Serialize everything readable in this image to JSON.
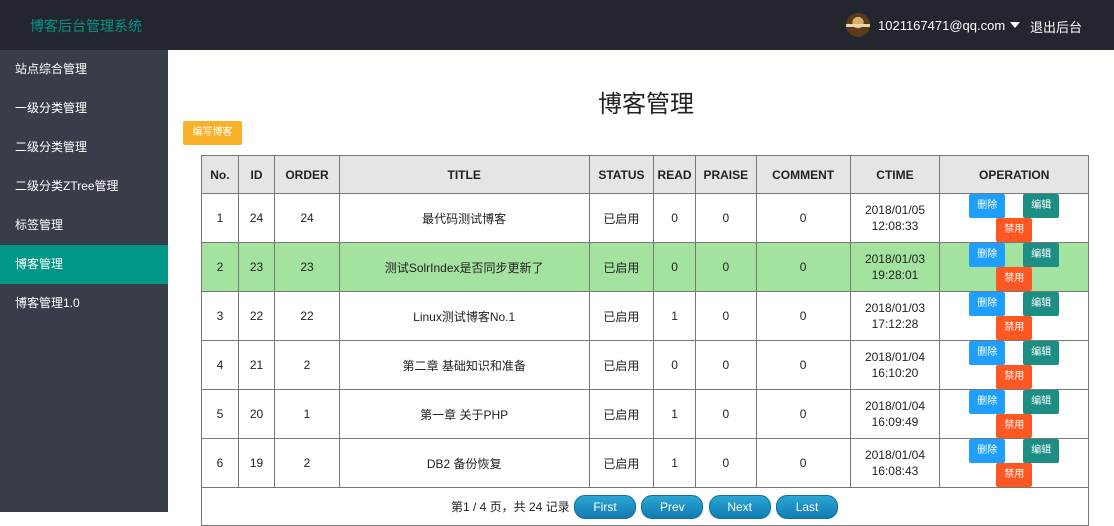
{
  "app": {
    "brand": "博客后台管理系统"
  },
  "header": {
    "user_email": "1021167471@qq.com",
    "logout": "退出后台"
  },
  "sidebar": {
    "items": [
      {
        "label": "站点综合管理"
      },
      {
        "label": "一级分类管理"
      },
      {
        "label": "二级分类管理"
      },
      {
        "label": "二级分类ZTree管理"
      },
      {
        "label": "标签管理"
      },
      {
        "label": "博客管理",
        "active": true
      },
      {
        "label": "博客管理1.0"
      }
    ]
  },
  "main": {
    "title": "博客管理",
    "write_button": "编写博客",
    "columns": [
      "No.",
      "ID",
      "ORDER",
      "TITLE",
      "STATUS",
      "READ",
      "PRAISE",
      "COMMENT",
      "CTIME",
      "OPERATION"
    ],
    "operations": {
      "delete": "删除",
      "edit": "编辑",
      "disable": "禁用"
    },
    "rows": [
      {
        "no": "1",
        "id": "24",
        "order": "24",
        "title": "最代码测试博客",
        "status": "已启用",
        "read": "0",
        "praise": "0",
        "comment": "0",
        "date": "2018/01/05",
        "time": "12:08:33"
      },
      {
        "no": "2",
        "id": "23",
        "order": "23",
        "title": "测试SolrIndex是否同步更新了",
        "status": "已启用",
        "read": "0",
        "praise": "0",
        "comment": "0",
        "date": "2018/01/03",
        "time": "19:28:01",
        "highlighted": true
      },
      {
        "no": "3",
        "id": "22",
        "order": "22",
        "title": "Linux测试博客No.1",
        "status": "已启用",
        "read": "1",
        "praise": "0",
        "comment": "0",
        "date": "2018/01/03",
        "time": "17:12:28"
      },
      {
        "no": "4",
        "id": "21",
        "order": "2",
        "title": "第二章 基础知识和准备",
        "status": "已启用",
        "read": "0",
        "praise": "0",
        "comment": "0",
        "date": "2018/01/04",
        "time": "16:10:20"
      },
      {
        "no": "5",
        "id": "20",
        "order": "1",
        "title": "第一章 关于PHP",
        "status": "已启用",
        "read": "1",
        "praise": "0",
        "comment": "0",
        "date": "2018/01/04",
        "time": "16:09:49"
      },
      {
        "no": "6",
        "id": "19",
        "order": "2",
        "title": "DB2 备份恢复",
        "status": "已启用",
        "read": "1",
        "praise": "0",
        "comment": "0",
        "date": "2018/01/04",
        "time": "16:08:43"
      }
    ],
    "pagination": {
      "info": "第1 / 4 页，共 24 记录",
      "first": "First",
      "prev": "Prev",
      "next": "Next",
      "last": "Last"
    }
  },
  "colors": {
    "topbar": "#23262e",
    "sidebar": "#393d49",
    "accent": "#009688",
    "highlight_row": "#a3e29f",
    "write_button": "#f7b22a",
    "delete": "#1e9fff",
    "edit": "#1d8e83",
    "disable": "#ff5722"
  }
}
